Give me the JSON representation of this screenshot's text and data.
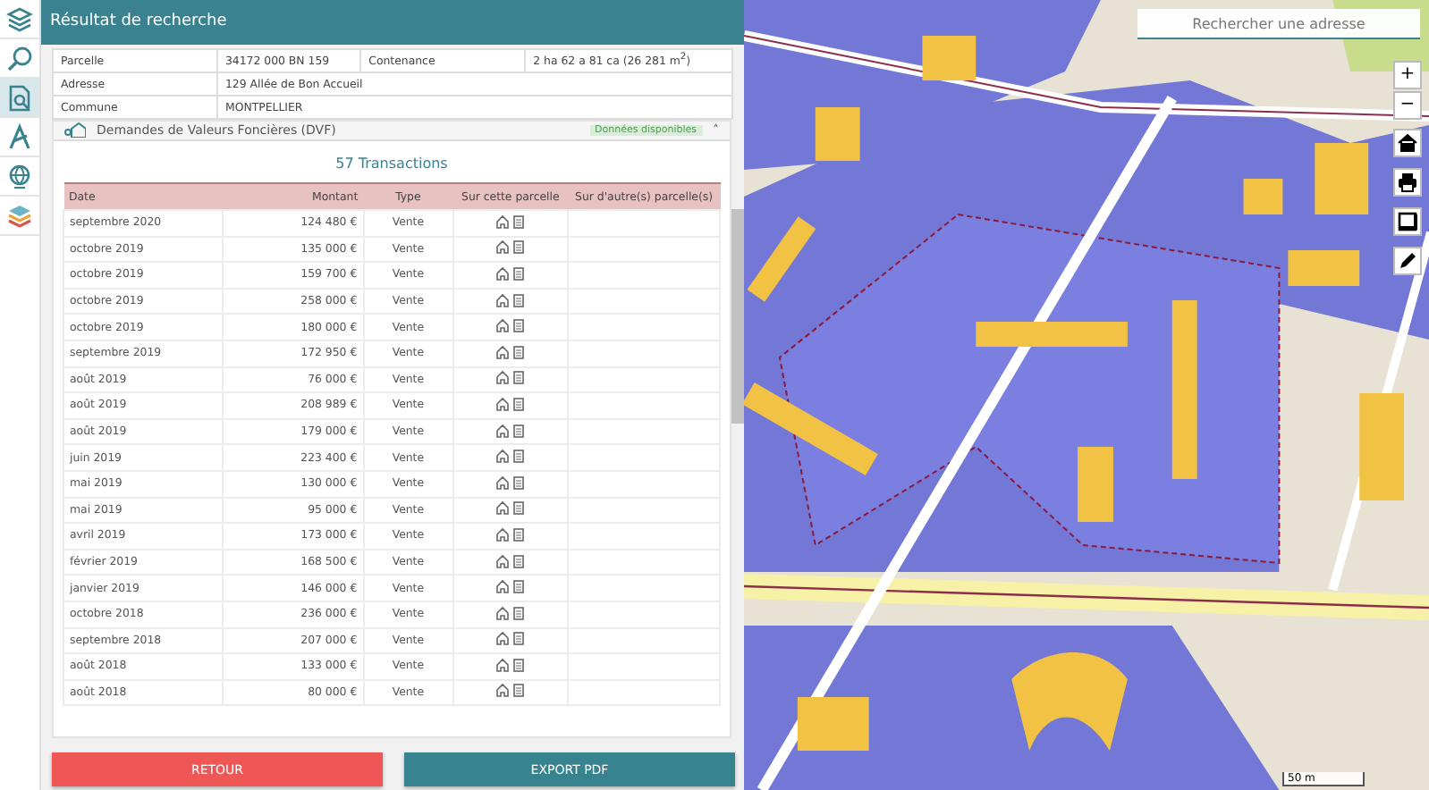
{
  "sidebar": {
    "items": [
      {
        "selected": false
      },
      {
        "selected": false
      },
      {
        "selected": true
      },
      {
        "selected": false
      },
      {
        "selected": false
      },
      {
        "selected": false
      }
    ]
  },
  "panel": {
    "title": "Résultat de recherche",
    "info": [
      [
        "Parcelle",
        "34172 000 BN 159",
        "Contenance",
        "2 ha 62 a 81 ca (26 281 m$^{2}$)"
      ],
      [
        "Adresse",
        "129 Allée de Bon Accueil"
      ],
      [
        "Commune",
        "MONTPELLIER"
      ]
    ],
    "section": {
      "title": "Demandes de Valeurs Foncières (DVF)",
      "badge": "Données disponibles",
      "toggle": "˄",
      "heading": "57 Transactions",
      "columns": [
        "Date",
        "Montant",
        "Type",
        "Sur cette parcelle",
        "Sur d'autre(s) parcelle(s)"
      ],
      "rows": [
        [
          "septembre 2020",
          "124 480 €",
          "Vente"
        ],
        [
          "octobre 2019",
          "135 000 €",
          "Vente"
        ],
        [
          "octobre 2019",
          "159 700 €",
          "Vente"
        ],
        [
          "octobre 2019",
          "258 000 €",
          "Vente"
        ],
        [
          "octobre 2019",
          "180 000 €",
          "Vente"
        ],
        [
          "septembre 2019",
          "172 950 €",
          "Vente"
        ],
        [
          "août 2019",
          "76 000 €",
          "Vente"
        ],
        [
          "août 2019",
          "208 989 €",
          "Vente"
        ],
        [
          "août 2019",
          "179 000 €",
          "Vente"
        ],
        [
          "juin 2019",
          "223 400 €",
          "Vente"
        ],
        [
          "mai 2019",
          "130 000 €",
          "Vente"
        ],
        [
          "mai 2019",
          "95 000 €",
          "Vente"
        ],
        [
          "avril 2019",
          "173 000 €",
          "Vente"
        ],
        [
          "février 2019",
          "168 500 €",
          "Vente"
        ],
        [
          "janvier 2019",
          "146 000 €",
          "Vente"
        ],
        [
          "octobre 2018",
          "236 000 €",
          "Vente"
        ],
        [
          "septembre 2018",
          "207 000 €",
          "Vente"
        ],
        [
          "août 2018",
          "133 000 €",
          "Vente"
        ],
        [
          "août 2018",
          "80 000 €",
          "Vente"
        ]
      ]
    },
    "buttons": [
      {
        "label": "RETOUR",
        "kind": "back"
      },
      {
        "label": "EXPORT PDF",
        "kind": "export"
      }
    ]
  },
  "map": {
    "search": {
      "placeholder": "Rechercher une adresse"
    },
    "controls": [
      "+",
      "−"
    ],
    "scale": "50 m"
  }
}
